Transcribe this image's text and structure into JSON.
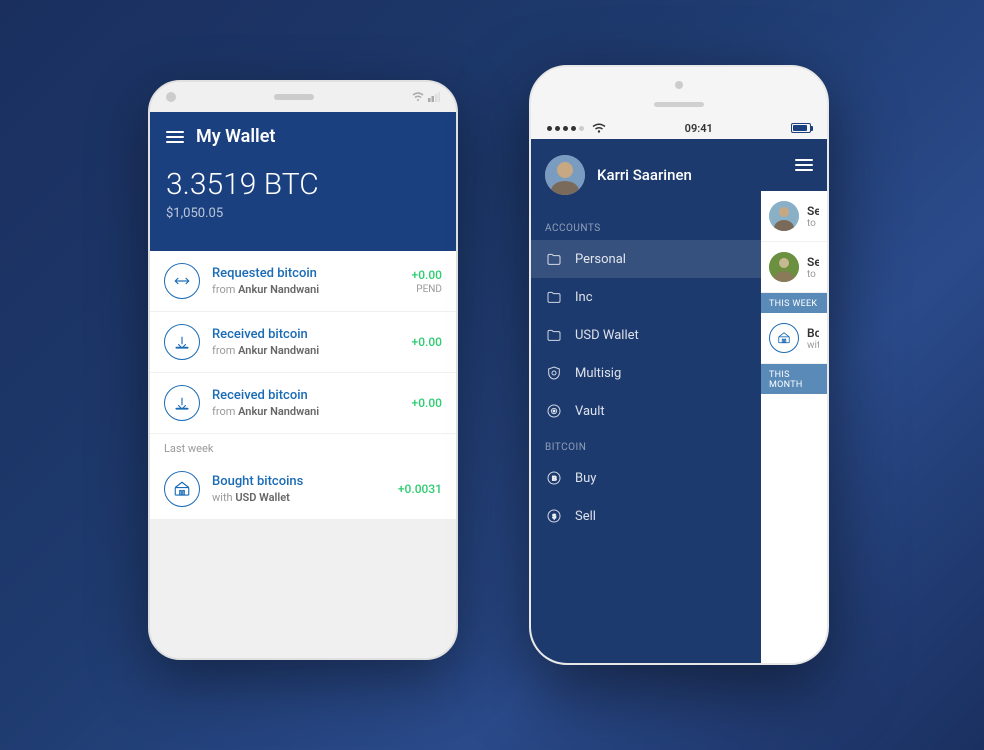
{
  "background": {
    "gradient_start": "#1a2f5e",
    "gradient_end": "#1a3060"
  },
  "android_phone": {
    "header": {
      "menu_label": "menu",
      "title": "My Wallet",
      "btc_amount": "3.3519 BTC",
      "usd_amount": "$1,050.05"
    },
    "transactions": [
      {
        "label": "Requested bitcoin",
        "from": "from",
        "from_name": "Ankur Nandwani",
        "amount": "+0.00",
        "status": "PEND",
        "icon": "arrows"
      },
      {
        "label": "Received bitcoin",
        "from": "from",
        "from_name": "Ankur Nandwani",
        "amount": "+0.00",
        "status": "",
        "icon": "download"
      },
      {
        "label": "Received bitcoin",
        "from": "from",
        "from_name": "Ankur Nandwani",
        "amount": "+0.00",
        "status": "",
        "icon": "download"
      }
    ],
    "sections": [
      {
        "label": "Last week",
        "transactions": [
          {
            "label": "Bought bitcoins",
            "sub": "with USD Wallet",
            "amount": "+0.0031",
            "icon": "bank"
          }
        ]
      }
    ]
  },
  "iphone": {
    "status_bar": {
      "dots": 5,
      "wifi": true,
      "time": "09:41",
      "battery": "full"
    },
    "sidebar": {
      "user": {
        "name": "Karri Saarinen"
      },
      "accounts_label": "ACCOUNTS",
      "accounts": [
        {
          "label": "Personal",
          "icon": "folder",
          "active": true
        },
        {
          "label": "Inc",
          "icon": "folder",
          "active": false
        },
        {
          "label": "USD Wallet",
          "icon": "folder",
          "active": false
        },
        {
          "label": "Multisig",
          "icon": "shield",
          "active": false
        },
        {
          "label": "Vault",
          "icon": "circle-lock",
          "active": false
        }
      ],
      "bitcoin_label": "BITCOIN",
      "bitcoin": [
        {
          "label": "Buy",
          "icon": "bitcoin"
        },
        {
          "label": "Sell",
          "icon": "dollar"
        }
      ]
    },
    "right_panel": {
      "transactions": [
        {
          "label": "Sent",
          "sub": "to Bria",
          "has_avatar": true,
          "avatar_color": "#8ab0c8"
        },
        {
          "label": "Sent",
          "sub": "to New",
          "has_avatar": true,
          "avatar_color": "#6a9040"
        }
      ],
      "week_label": "THIS WEEK",
      "month_label": "THIS MONTH",
      "bought": [
        {
          "label": "Boug",
          "sub": "with C",
          "icon": "bank"
        }
      ]
    }
  }
}
